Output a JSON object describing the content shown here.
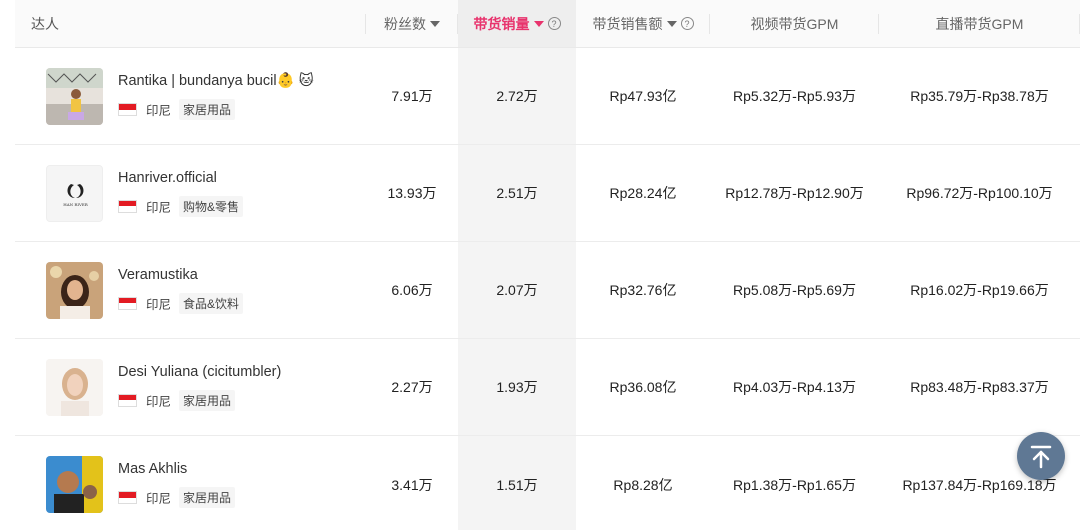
{
  "header": {
    "influencer": "达人",
    "fans": "粉丝数",
    "sales": "带货销量",
    "amount": "带货销售额",
    "video_gpm": "视频带货GPM",
    "live_gpm": "直播带货GPM",
    "help_glyph": "?"
  },
  "rows": [
    {
      "name": "Rantika | bundanya bucil👶 🐱",
      "country": "印尼",
      "tag": "家居用品",
      "fans": "7.91万",
      "sales": "2.72万",
      "amount": "Rp47.93亿",
      "video_gpm": "Rp5.32万-Rp5.93万",
      "live_gpm": "Rp35.79万-Rp38.78万"
    },
    {
      "name": "Hanriver.official",
      "country": "印尼",
      "tag": "购物&零售",
      "fans": "13.93万",
      "sales": "2.51万",
      "amount": "Rp28.24亿",
      "video_gpm": "Rp12.78万-Rp12.90万",
      "live_gpm": "Rp96.72万-Rp100.10万"
    },
    {
      "name": "Veramustika",
      "country": "印尼",
      "tag": "食品&饮料",
      "fans": "6.06万",
      "sales": "2.07万",
      "amount": "Rp32.76亿",
      "video_gpm": "Rp5.08万-Rp5.69万",
      "live_gpm": "Rp16.02万-Rp19.66万"
    },
    {
      "name": "Desi Yuliana (cicitumbler)",
      "country": "印尼",
      "tag": "家居用品",
      "fans": "2.27万",
      "sales": "1.93万",
      "amount": "Rp36.08亿",
      "video_gpm": "Rp4.03万-Rp4.13万",
      "live_gpm": "Rp83.48万-Rp83.37万"
    },
    {
      "name": "Mas Akhlis",
      "country": "印尼",
      "tag": "家居用品",
      "fans": "3.41万",
      "sales": "1.51万",
      "amount": "Rp8.28亿",
      "video_gpm": "Rp1.38万-Rp1.65万",
      "live_gpm": "Rp137.84万-Rp169.18万"
    }
  ],
  "logo_text": "HAN RIVER",
  "colors": {
    "accent": "#e8336d",
    "fab": "#5f7894",
    "flag_red": "#e31b23"
  },
  "icons": {
    "sort": "caret-down",
    "help": "question-circle",
    "fab": "back-to-top-arrow"
  }
}
